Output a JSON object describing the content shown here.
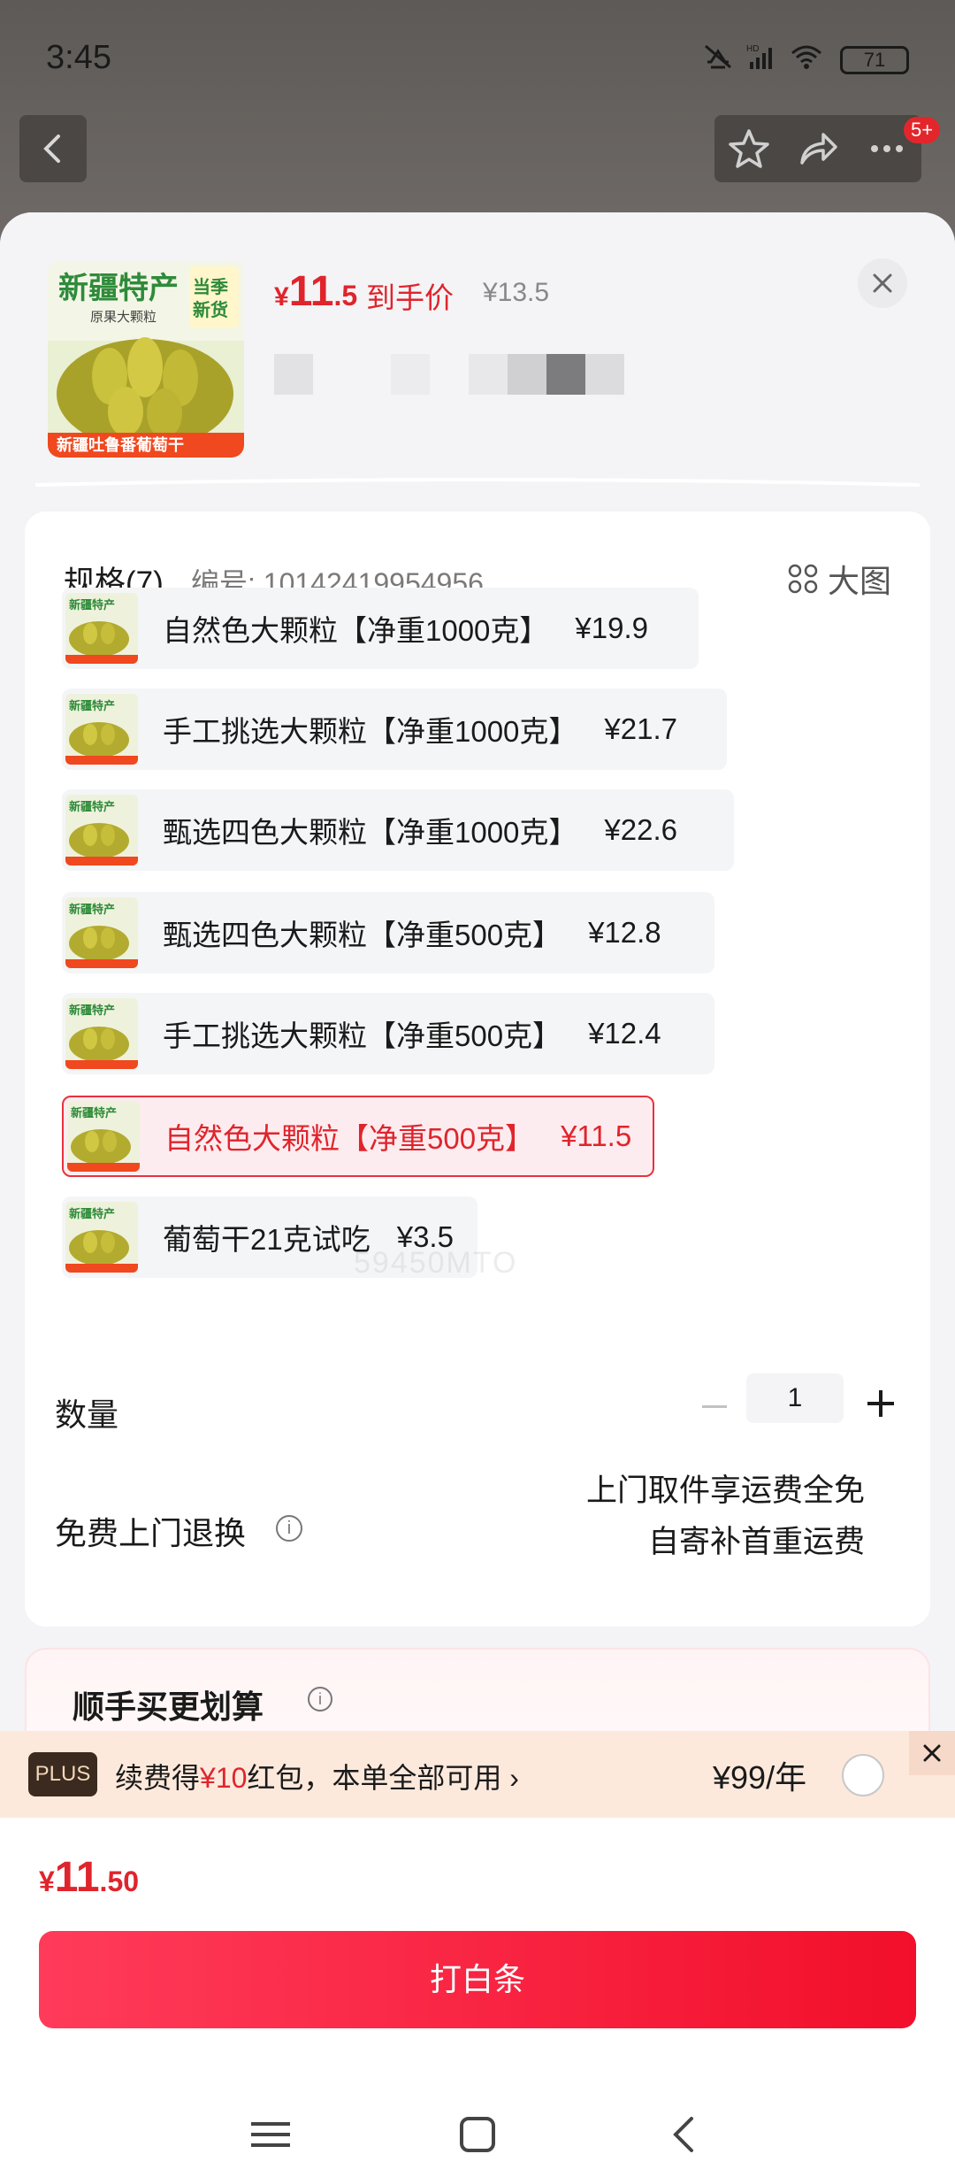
{
  "status_bar": {
    "time": "3:45",
    "battery": "71",
    "network": "HD"
  },
  "top_actions": {
    "badge": "5+"
  },
  "product": {
    "price_symbol": "¥",
    "price_int": "11",
    "price_dec": ".5",
    "price_label": "到手价",
    "original_price": "¥13.5",
    "image_text": {
      "brand": "新疆特产",
      "tag": "当季新货",
      "sub": "原果大颗粒",
      "bottom": "新疆吐鲁番葡萄干"
    }
  },
  "spec": {
    "title": "规格(7)",
    "code": "编号: 10142419954956",
    "big_image_label": "大图",
    "options": [
      {
        "name": "自然色大颗粒【净重1000克】",
        "price": "¥19.9",
        "selected": false
      },
      {
        "name": "手工挑选大颗粒【净重1000克】",
        "price": "¥21.7",
        "selected": false
      },
      {
        "name": "甄选四色大颗粒【净重1000克】",
        "price": "¥22.6",
        "selected": false
      },
      {
        "name": "甄选四色大颗粒【净重500克】",
        "price": "¥12.8",
        "selected": false
      },
      {
        "name": "手工挑选大颗粒【净重500克】",
        "price": "¥12.4",
        "selected": false
      },
      {
        "name": "自然色大颗粒【净重500克】",
        "price": "¥11.5",
        "selected": true
      },
      {
        "name": "葡萄干21克试吃",
        "price": "¥3.5",
        "selected": false
      }
    ]
  },
  "quantity": {
    "label": "数量",
    "value": "1"
  },
  "returns": {
    "label": "免费上门退换",
    "line1": "上门取件享运费全免",
    "line2": "自寄补首重运费"
  },
  "more": {
    "title": "顺手买更划算"
  },
  "plus": {
    "tag": "PLUS",
    "text_pre": "续费得",
    "text_amount": "¥10",
    "text_post": "红包，本单全部可用 ›",
    "price": "¥99/年"
  },
  "bottom": {
    "total_symbol": "¥",
    "total_int": "11",
    "total_dec": ".50",
    "checkout_label": "打白条"
  },
  "watermark": "59450MTO",
  "colors": {
    "accent": "#e0242c",
    "selected_bg": "#fdecef",
    "plus_bg": "#fde9dc"
  }
}
